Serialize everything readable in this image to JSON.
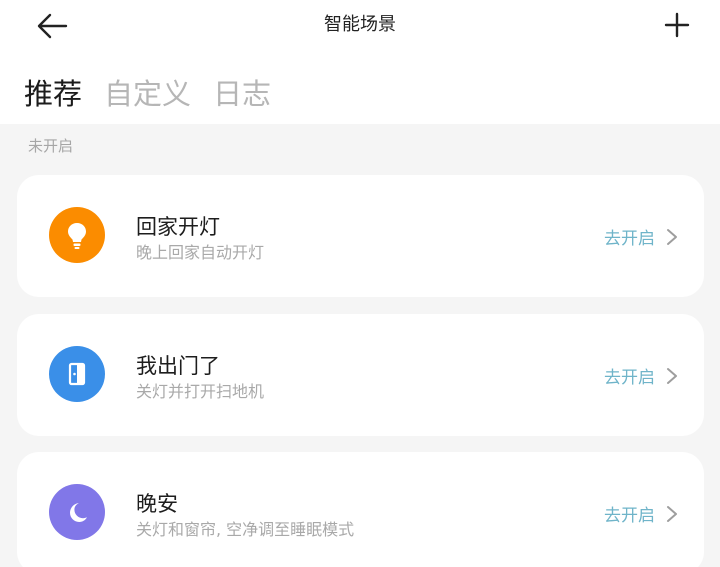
{
  "header": {
    "title": "智能场景",
    "back_icon": "back-arrow-icon",
    "add_icon": "plus-icon"
  },
  "tabs": [
    {
      "label": "推荐",
      "active": true
    },
    {
      "label": "自定义",
      "active": false
    },
    {
      "label": "日志",
      "active": false
    }
  ],
  "section_label": "未开启",
  "scenes": [
    {
      "name": "回家开灯",
      "desc": "晚上回家自动开灯",
      "action": "去开启",
      "icon": "lightbulb-icon",
      "color": "#fb8c00"
    },
    {
      "name": "我出门了",
      "desc": "关灯并打开扫地机",
      "action": "去开启",
      "icon": "door-icon",
      "color": "#3a8fe8"
    },
    {
      "name": "晚安",
      "desc": "关灯和窗帘, 空净调至睡眠模式",
      "action": "去开启",
      "icon": "moon-icon",
      "color": "#8177e8"
    }
  ],
  "colors": {
    "accent": "#6fb4c9",
    "background": "#f5f5f5"
  }
}
